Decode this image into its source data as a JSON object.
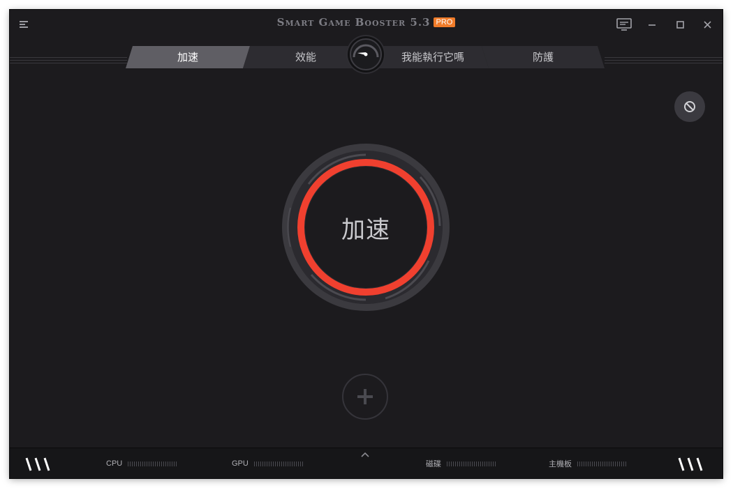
{
  "app": {
    "title": "Smart Game Booster 5.3",
    "badge": "PRO",
    "accent_color": "#f0402f",
    "badge_color": "#f17c2a"
  },
  "titlebar_icons": [
    "menu-icon",
    "feedback-icon",
    "minimize-icon",
    "maximize-icon",
    "close-icon"
  ],
  "tabs": [
    {
      "label": "加速",
      "active": true
    },
    {
      "label": "效能",
      "active": false
    },
    {
      "label": "我能執行它嗎",
      "active": false
    },
    {
      "label": "防護",
      "active": false
    }
  ],
  "main": {
    "boost_label": "加速",
    "block_icon": "block-icon",
    "add_icon": "plus-icon"
  },
  "status": {
    "meters": [
      {
        "label": "CPU"
      },
      {
        "label": "GPU"
      },
      {
        "label": "磁碟"
      },
      {
        "label": "主機板"
      }
    ]
  }
}
